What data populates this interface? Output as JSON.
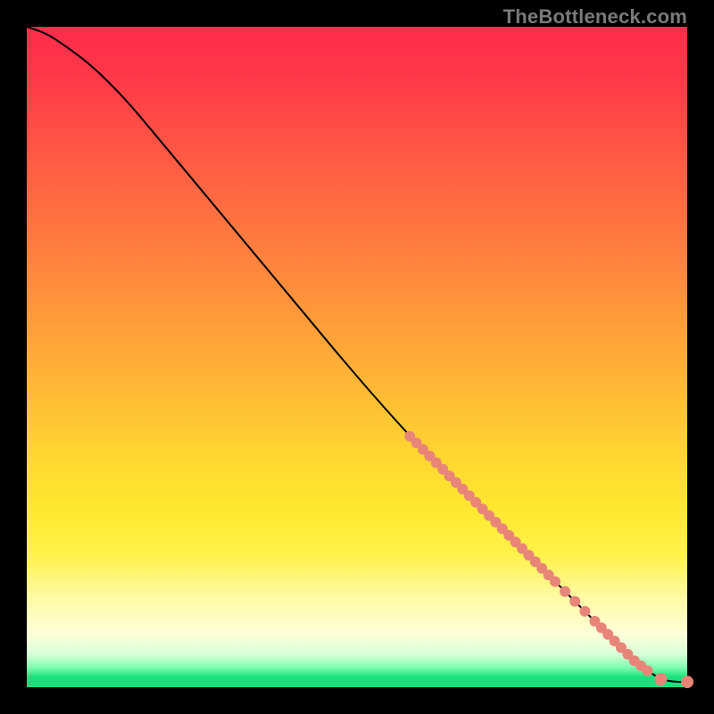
{
  "watermark": "TheBottleneck.com",
  "colors": {
    "line": "#000000",
    "point_fill": "#e88578",
    "point_stroke": "#c46a5f",
    "bg_black": "#000000"
  },
  "chart_data": {
    "type": "line",
    "title": "",
    "xlabel": "",
    "ylabel": "",
    "xlim": [
      0,
      100
    ],
    "ylim": [
      0,
      100
    ],
    "grid": false,
    "series": [
      {
        "name": "curve",
        "x": [
          0,
          3,
          6,
          10,
          15,
          20,
          30,
          40,
          50,
          58,
          62,
          66,
          70,
          74,
          78,
          80,
          83,
          86,
          88,
          90,
          92,
          94,
          96,
          98,
          100
        ],
        "y": [
          100,
          99,
          97,
          94,
          89,
          83,
          71,
          59,
          47,
          38,
          34,
          30,
          26,
          22,
          18,
          16,
          13,
          10,
          8,
          6,
          4,
          2.5,
          1.2,
          0.8,
          0.8
        ]
      }
    ],
    "points_on_curve_x": [
      58,
      60,
      62,
      64,
      66,
      68,
      70,
      72,
      74,
      76,
      78,
      80,
      83,
      86,
      88,
      90,
      92,
      94
    ],
    "end_points_x": [
      96,
      100
    ],
    "point_radius_small": 6,
    "point_radius_end": 7
  }
}
